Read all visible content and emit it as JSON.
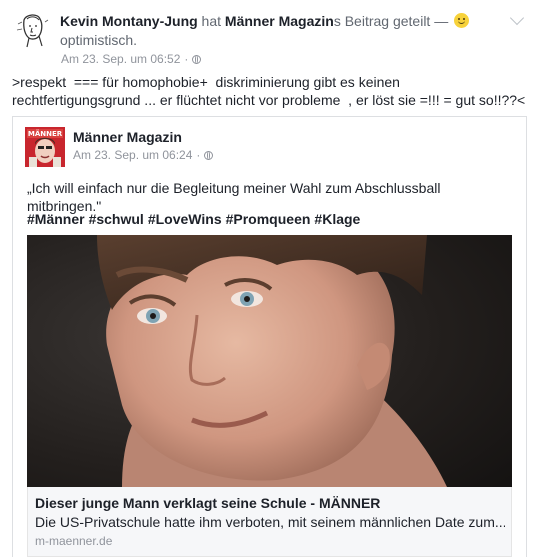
{
  "post": {
    "author": "Kevin Montany-Jung",
    "action_hat": " hat ",
    "shared_page": "Männer Magazin",
    "action_rest": "s Beitrag geteilt — ",
    "feeling": "optimistisch.",
    "timestamp": "Am 23. Sep. um 06:52",
    "separator": "·",
    "privacy_icon": "globe-icon",
    "status_text": ">respekt  === für homophobie+  diskriminierung gibt es keinen rechtfertigungsgrund ... er flüchtet nicht vor probleme  , er löst sie =!!! = gut so!!??<"
  },
  "shared": {
    "page_name": "Männer Magazin",
    "timestamp": "Am 23. Sep. um 06:24",
    "separator": "·",
    "quote": "„Ich will einfach nur die Begleitung meiner Wahl zum Abschlussball mitbringen.\"",
    "hashtags": [
      "#Männer",
      "#schwul",
      "#LoveWins",
      "#Promqueen",
      "#Klage"
    ],
    "link": {
      "title": "Dieser junge Mann verklagt seine Schule - MÄNNER",
      "description": "Die US-Privatschule hatte ihm verboten, mit seinem männlichen Date zum...",
      "domain": "m-maenner.de"
    }
  },
  "colors": {
    "text": "#1d2129",
    "meta": "#90949c",
    "border": "#dddfe2",
    "link_bg": "#f6f7f9"
  }
}
